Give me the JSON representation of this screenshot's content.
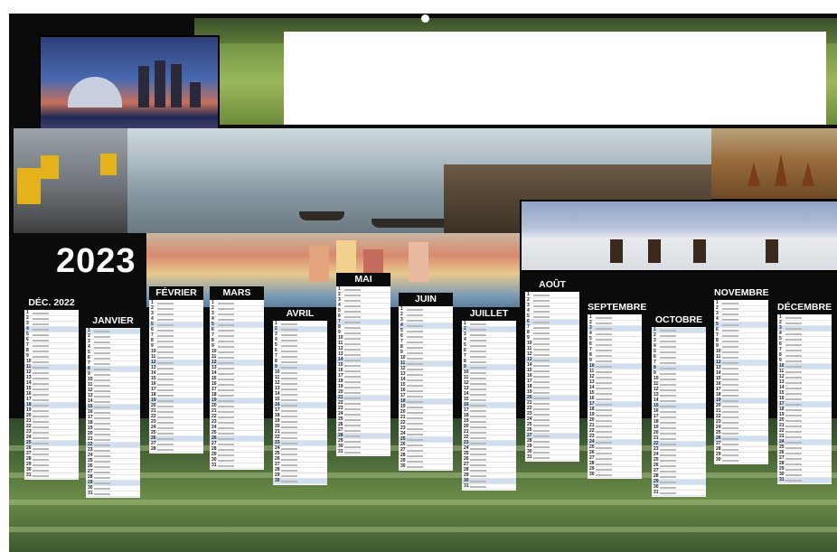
{
  "calendar": {
    "year": "2023",
    "months": [
      {
        "name": "DÉC. 2022",
        "days": 31,
        "first_weekday": 3
      },
      {
        "name": "JANVIER",
        "days": 31,
        "first_weekday": 6
      },
      {
        "name": "FÉVRIER",
        "days": 28,
        "first_weekday": 2
      },
      {
        "name": "MARS",
        "days": 31,
        "first_weekday": 2
      },
      {
        "name": "AVRIL",
        "days": 30,
        "first_weekday": 5
      },
      {
        "name": "MAI",
        "days": 31,
        "first_weekday": 0
      },
      {
        "name": "JUIN",
        "days": 30,
        "first_weekday": 3
      },
      {
        "name": "JUILLET",
        "days": 31,
        "first_weekday": 5
      },
      {
        "name": "AOÛT",
        "days": 31,
        "first_weekday": 1
      },
      {
        "name": "SEPTEMBRE",
        "days": 30,
        "first_weekday": 4
      },
      {
        "name": "OCTOBRE",
        "days": 31,
        "first_weekday": 6
      },
      {
        "name": "NOVEMBRE",
        "days": 30,
        "first_weekday": 2
      },
      {
        "name": "DÉCEMBRE",
        "days": 31,
        "first_weekday": 4
      }
    ]
  },
  "colors": {
    "background": "#0b0b0b",
    "weekend_row": "#cfe0f2",
    "holiday_row": "#ffd9d9",
    "holiday_mark": "#dd2222"
  },
  "photos": [
    "rice-terrace-landscape",
    "singapore-skyline",
    "cyclo-street",
    "river-market",
    "bagan-temples",
    "eagle-hunters",
    "procida-harbour",
    "rice-terraces-bottom"
  ]
}
